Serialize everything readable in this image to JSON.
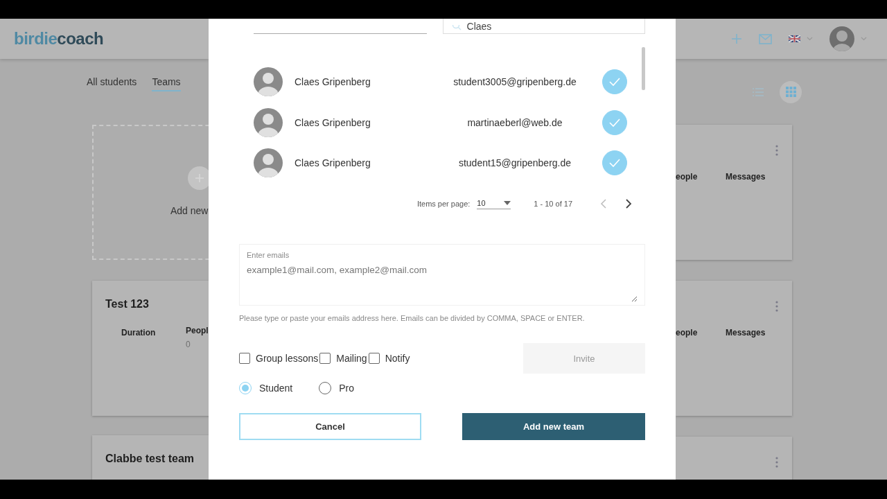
{
  "header": {
    "logo": {
      "light": "birdie",
      "dark": "coach"
    }
  },
  "tabs": [
    {
      "label": "All students",
      "selected": false
    },
    {
      "label": "Teams",
      "selected": true
    }
  ],
  "view_toggle": [
    {
      "kind": "list",
      "selected": false
    },
    {
      "kind": "grid",
      "selected": true
    }
  ],
  "cards_left": [
    {
      "kind": "add",
      "label": "Add new"
    },
    {
      "kind": "team",
      "title": "Test 123",
      "column_1": "Duration",
      "column_2": "Peopl",
      "count": "0"
    },
    {
      "kind": "title",
      "title": "Clabbe test team"
    }
  ],
  "cards_right": [
    {
      "kind": "stats",
      "column_1": "eople",
      "column_2": "Messages"
    },
    {
      "kind": "stats",
      "column_1": "eople",
      "column_2": "Messages"
    },
    {
      "kind": "menu"
    }
  ],
  "modal": {
    "search": {
      "value": "Claes"
    },
    "students": [
      {
        "name": "Claes Gripenberg",
        "email": "student3005@gripenberg.de",
        "selected": true
      },
      {
        "name": "Claes Gripenberg",
        "email": "martinaeberl@web.de",
        "selected": true
      },
      {
        "name": "Claes Gripenberg",
        "email": "student15@gripenberg.de",
        "selected": true
      }
    ],
    "pagination": {
      "label": "Items per page:",
      "per_page": "10",
      "range": "1 - 10 of 17"
    },
    "emails": {
      "label": "Enter emails",
      "placeholder": "example1@mail.com, example2@mail.com",
      "hint": "Please type or paste your emails address here. Emails can be divided by COMMA, SPACE or ENTER."
    },
    "options": [
      {
        "label": "Group lessons",
        "checked": false
      },
      {
        "label": "Mailing",
        "checked": false
      },
      {
        "label": "Notify",
        "checked": false
      }
    ],
    "invite_button": {
      "label": "Invite",
      "disabled": true
    },
    "roles": [
      {
        "label": "Student",
        "selected": true
      },
      {
        "label": "Pro",
        "selected": false
      }
    ],
    "cancel_button": "Cancel",
    "submit_button": "Add new team"
  }
}
